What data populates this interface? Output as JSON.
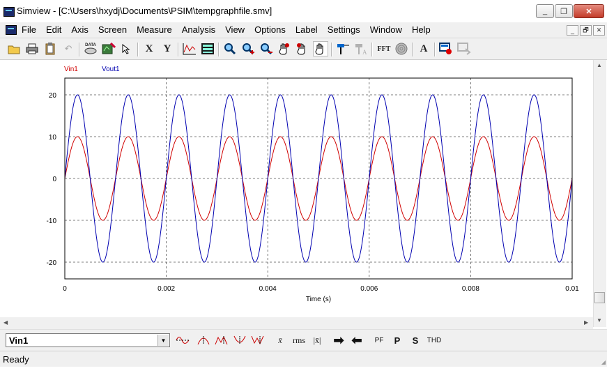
{
  "window": {
    "title": "Simview - [C:\\Users\\hxydj\\Documents\\PSIM\\tempgraphfile.smv]",
    "minimize_label": "_",
    "restore_label": "❐",
    "close_label": "✕"
  },
  "menu": [
    "File",
    "Edit",
    "Axis",
    "Screen",
    "Measure",
    "Analysis",
    "View",
    "Options",
    "Label",
    "Settings",
    "Window",
    "Help"
  ],
  "mdi_buttons": [
    "_",
    "🗗",
    "✕"
  ],
  "toolbar": {
    "x_label": "X",
    "y_label": "Y",
    "fft_label": "FFT",
    "data_label": "DATA",
    "text_label": "A"
  },
  "bottom_toolbar": {
    "selected_curve": "Vin1",
    "rms_label": "rms",
    "pf_label": "PF",
    "p_label": "P",
    "s_label": "S",
    "thd_label": "THD"
  },
  "status": "Ready",
  "colors": {
    "vin": "#d00000",
    "vout": "#0000b0",
    "legend_vin": "#d00000",
    "legend_vout": "#0000b0"
  },
  "chart_data": {
    "type": "line",
    "xlabel": "Time (s)",
    "ylabel": "",
    "xlim": [
      0,
      0.01
    ],
    "ylim": [
      -24,
      24
    ],
    "x_ticks": [
      "0",
      "0.002",
      "0.004",
      "0.006",
      "0.008",
      "0.01"
    ],
    "y_ticks": [
      "20",
      "10",
      "0",
      "-10",
      "-20"
    ],
    "grid": true,
    "series": [
      {
        "name": "Vin1",
        "amplitude": 10,
        "frequency_hz": 1000,
        "phase": 0
      },
      {
        "name": "Vout1",
        "amplitude": 20,
        "frequency_hz": 1000,
        "phase": 0
      }
    ]
  }
}
